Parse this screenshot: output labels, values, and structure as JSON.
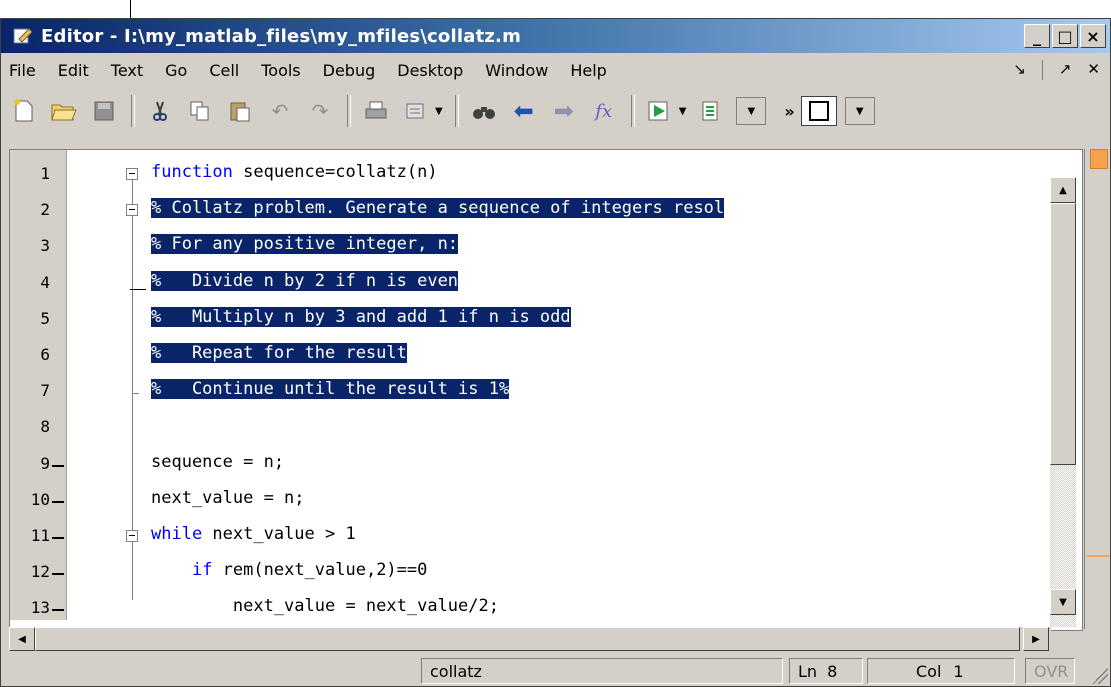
{
  "window": {
    "title": "Editor - I:\\my_matlab_files\\my_mfiles\\collatz.m",
    "title_buttons": [
      "_",
      "□",
      "×"
    ]
  },
  "menu": {
    "items": [
      "File",
      "Edit",
      "Text",
      "Go",
      "Cell",
      "Tools",
      "Debug",
      "Desktop",
      "Window",
      "Help"
    ],
    "right_icons": [
      "dock-icon",
      "undock-icon",
      "close-icon"
    ]
  },
  "toolbar": {
    "icons": [
      "new-file-icon",
      "open-folder-icon",
      "save-icon",
      "cut-icon",
      "copy-icon",
      "paste-icon",
      "undo-icon",
      "redo-icon",
      "print-icon",
      "find-files-icon",
      "find-icon",
      "back-icon",
      "forward-icon",
      "function-icon",
      "run-icon",
      "stack-icon"
    ],
    "function_label": "fx",
    "overflow": "»"
  },
  "editor": {
    "lines": [
      {
        "num": "1",
        "breakpoint": false,
        "text_kw": "function",
        "text": " sequence=collatz(n)",
        "selected": false
      },
      {
        "num": "2",
        "breakpoint": false,
        "text": "% Collatz problem. Generate a sequence of integers resol",
        "selected": true
      },
      {
        "num": "3",
        "breakpoint": false,
        "text": "% For any positive integer, n:",
        "selected": true
      },
      {
        "num": "4",
        "breakpoint": false,
        "text": "%   Divide n by 2 if n is even",
        "selected": true
      },
      {
        "num": "5",
        "breakpoint": false,
        "text": "%   Multiply n by 3 and add 1 if n is odd",
        "selected": true
      },
      {
        "num": "6",
        "breakpoint": false,
        "text": "%   Repeat for the result",
        "selected": true
      },
      {
        "num": "7",
        "breakpoint": false,
        "text": "%   Continue until the result is 1%",
        "selected": true
      },
      {
        "num": "8",
        "breakpoint": false,
        "text": "",
        "selected": false
      },
      {
        "num": "9",
        "breakpoint": true,
        "text": "sequence = n;",
        "selected": false
      },
      {
        "num": "10",
        "breakpoint": true,
        "text": "next_value = n;",
        "selected": false
      },
      {
        "num": "11",
        "breakpoint": true,
        "text_kw": "while",
        "text": " next_value > 1",
        "selected": false
      },
      {
        "num": "12",
        "breakpoint": true,
        "text_indent": "    ",
        "text_kw": "if",
        "text": " rem(next_value,2)==0",
        "selected": false
      },
      {
        "num": "13",
        "breakpoint": true,
        "text": "        next_value = next_value/2;",
        "selected": false
      }
    ]
  },
  "status": {
    "file": "collatz",
    "ln_label": "Ln",
    "ln_value": "8",
    "col_label": "Col",
    "col_value": "1",
    "ovr": "OVR"
  }
}
